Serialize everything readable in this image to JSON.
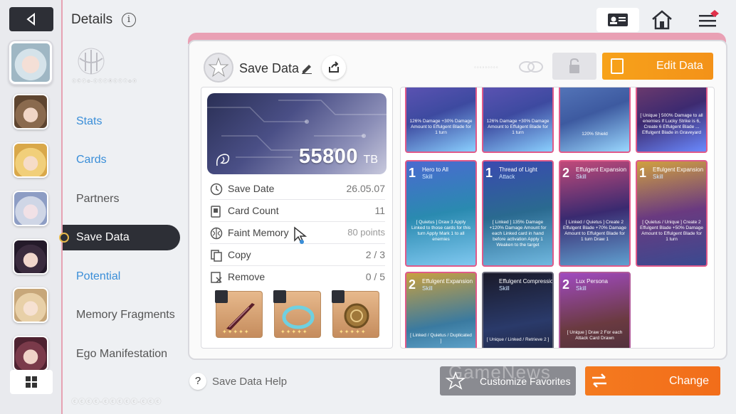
{
  "header": {
    "title": "Details",
    "info_icon": "info-icon"
  },
  "emblem_caption": "ⓒⒸⓡ⊙-ⓒⓣⓡⒶⓒⓣⓘ⊙ⓝ",
  "nav": [
    {
      "label": "Stats",
      "style": "link"
    },
    {
      "label": "Cards",
      "style": "link"
    },
    {
      "label": "Partners",
      "style": "normal"
    },
    {
      "label": "Save Data",
      "style": "active"
    },
    {
      "label": "Potential",
      "style": "link"
    },
    {
      "label": "Memory Fragments",
      "style": "normal"
    },
    {
      "label": "Ego Manifestation",
      "style": "normal"
    }
  ],
  "save": {
    "title": "Save Data",
    "faint_label": "◦◦◦◦◦◦◦◦◦",
    "edit_label": "Edit Data",
    "tb_value": "55800",
    "tb_unit": "TB",
    "rows": [
      {
        "label": "Save Date",
        "value": "26.05.07",
        "icon": "clock-icon"
      },
      {
        "label": "Card Count",
        "value": "11",
        "icon": "card-icon"
      },
      {
        "label": "Faint Memory",
        "value": "80 points",
        "icon": "brain-icon"
      },
      {
        "label": "Copy",
        "value": "2 / 3",
        "icon": "copy-icon"
      },
      {
        "label": "Remove",
        "value": "0 / 5",
        "icon": "remove-icon"
      }
    ]
  },
  "cards": {
    "row1": [
      {
        "text": "126% Damage +30% Damage Amount to Effulgent Blade for 1 turn"
      },
      {
        "text": "126% Damage +30% Damage Amount to Effulgent Blade for 1 turn"
      },
      {
        "text": "120% Shield"
      },
      {
        "text": "[ Unique ] 500% Damage to all enemies If Lucky Strike is 6, Create 6 Effulgent Blade ... Effulgent Blade in Graveyard"
      }
    ],
    "row2": [
      {
        "cost": "1",
        "name": "Hero to All",
        "type": "Skill",
        "text": "[ Quietus ] Draw 3 Apply Linked to those cards for this turn Apply Mark 1 to all enemies"
      },
      {
        "cost": "1",
        "name": "Thread of Light",
        "type": "Attack",
        "text": "[ Linked ] 135% Damage +120% Damage Amount for each Linked card in hand before activation Apply 1 Weaken to the target"
      },
      {
        "cost": "2",
        "name": "Effulgent Expansion",
        "type": "Skill",
        "text": "[ Linked / Quietus ] Create 2 Effulgent Blade +70% Damage Amount to Effulgent Blade for 1 turn Draw 1"
      },
      {
        "cost": "1",
        "name": "Effulgent Expansion",
        "type": "Skill",
        "text": "[ Quietus / Unique ] Create 2 Effulgent Blade +50% Damage Amount to Effulgent Blade for 1 turn"
      }
    ],
    "row3": [
      {
        "cost": "2",
        "name": "Effulgent Expansion",
        "type": "Skill",
        "text": "[ Linked / Quietus / Duplicated ]"
      },
      {
        "cost": "",
        "name": "Effulgent Compression",
        "type": "Skill",
        "text": "[ Unique / Linked / Retrieve 2 ]"
      },
      {
        "cost": "2",
        "name": "Lux Persona",
        "type": "Skill",
        "text": "[ Unique ] Draw 2 For each Attack Card Drawn"
      }
    ]
  },
  "footer": {
    "help_label": "Save Data Help",
    "favorites_label": "Customize Favorites",
    "change_label": "Change",
    "faint": "ⓒⓒⓒⓒ-ⓒⓒⓒⓒⓒ-ⓒⓒⓒ",
    "watermark": "GameNews"
  },
  "colors": {
    "accent_orange": "#f39219",
    "change_orange": "#f26d1a",
    "link_blue": "#3a8ed8",
    "pink": "#e05a8a",
    "dark": "#2d2f36"
  }
}
